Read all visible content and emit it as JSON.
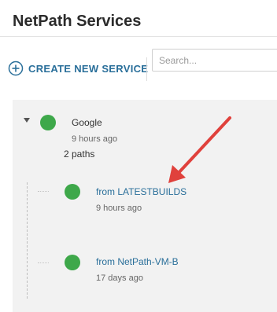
{
  "header": {
    "title": "NetPath Services"
  },
  "toolbar": {
    "create_label": "CREATE NEW SERVICE",
    "create_icon": "plus-circle-icon",
    "search_placeholder": "Search...",
    "search_value": ""
  },
  "services": [
    {
      "name": "Google",
      "status_color": "#3ea84a",
      "status": "up",
      "updated": "9 hours ago",
      "paths_label": "2 paths",
      "expanded": true,
      "paths": [
        {
          "label": "from LATESTBUILDS",
          "updated": "9 hours ago",
          "status_color": "#3ea84a"
        },
        {
          "label": "from NetPath-VM-B",
          "updated": "17 days ago",
          "status_color": "#3ea84a"
        }
      ]
    }
  ],
  "annotation": {
    "arrow_color": "#e0413c"
  },
  "colors": {
    "link": "#2a6f9a",
    "status_up": "#3ea84a",
    "panel_bg": "#f2f2f2"
  }
}
